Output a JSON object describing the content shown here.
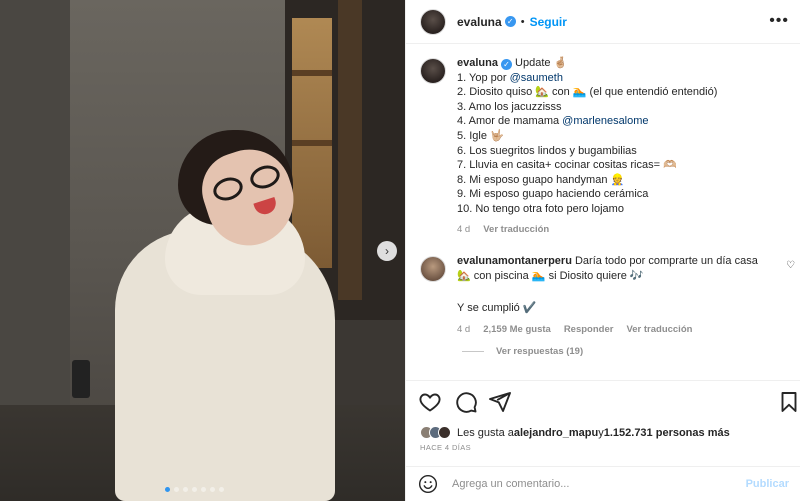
{
  "post": {
    "username": "evaluna",
    "follow_label": "Seguir",
    "separator": "•",
    "more_icon": "more-horizontal-icon",
    "carousel": {
      "slide_count": 7,
      "active_slide": 1
    }
  },
  "caption": {
    "username": "evaluna",
    "first_line": "Update 🤞🏼",
    "lines": [
      {
        "text": "1. Yop por ",
        "mention": "@saumeth"
      },
      {
        "text": "2. Diosito quiso 🏡 con 🏊 (el que entendió entendió)"
      },
      {
        "text": "3. Amo los jacuzzisss"
      },
      {
        "text": "4. Amor de mamama ",
        "mention": "@marlenesalome"
      },
      {
        "text": "5. Igle 🤟🏼"
      },
      {
        "text": "6. Los suegritos lindos y bugambilias"
      },
      {
        "text": "7. Lluvia en casita+ cocinar cositas ricas= 🫶🏼"
      },
      {
        "text": "8. Mi esposo guapo handyman 👷"
      },
      {
        "text": "9. Mi esposo guapo haciendo cerámica"
      },
      {
        "text": "10. No tengo otra foto pero lojamo"
      }
    ],
    "age": "4 d",
    "translate_label": "Ver traducción"
  },
  "comment": {
    "username": "evalunamontanerperu",
    "text": "Daría todo por comprarte un día casa 🏡 con piscina 🏊 si Diosito quiere 🎶",
    "reply_line": "Y se cumplió ✔️",
    "age": "4 d",
    "likes_label": "2,159 Me gusta",
    "reply_label": "Responder",
    "translate_label": "Ver traducción",
    "view_replies_label": "Ver respuestas (19)"
  },
  "likes": {
    "prefix": "Les gusta a ",
    "user": "alejandro_mapu",
    "middle": " y ",
    "count": "1.152.731 personas más"
  },
  "time_ago": "HACE 4 DÍAS",
  "add_comment": {
    "placeholder": "Agrega un comentario...",
    "post_label": "Publicar"
  },
  "colors": {
    "accent": "#0095f6",
    "verified": "#3897f0",
    "muted": "#8e8e8e",
    "mention": "#00376b",
    "post_disabled": "#b3dbff"
  }
}
